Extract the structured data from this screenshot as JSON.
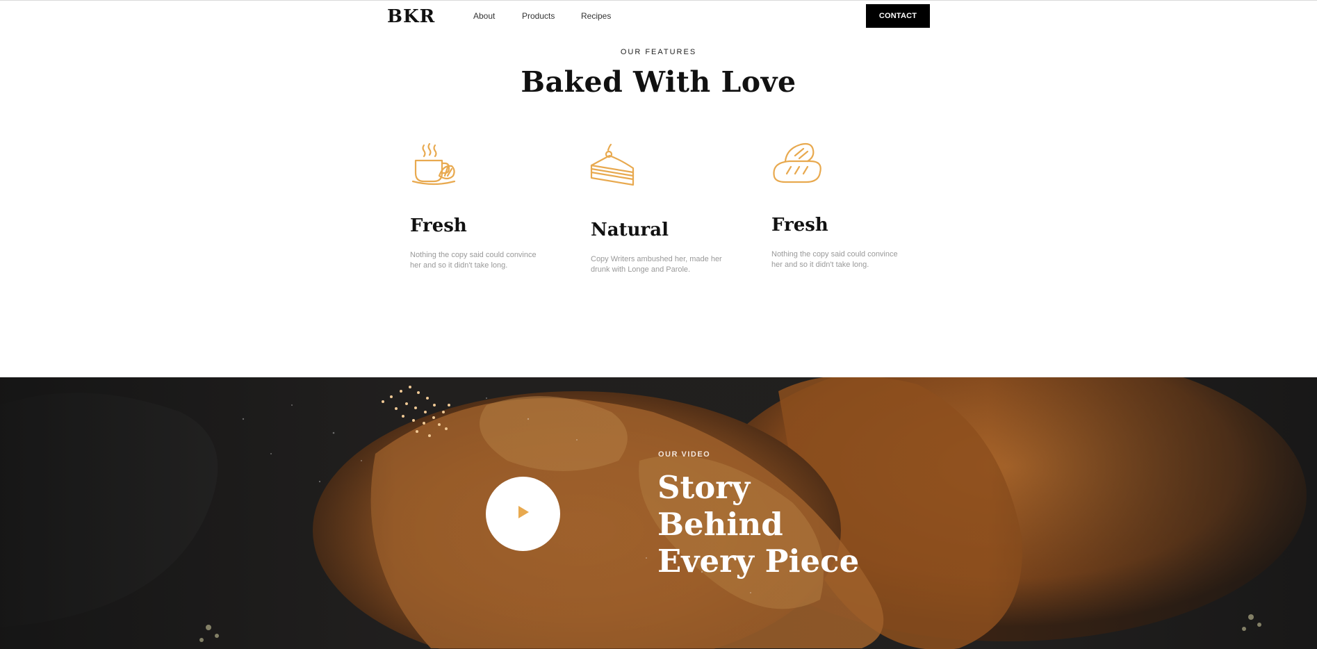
{
  "nav": {
    "logo": "BKR",
    "links": [
      "About",
      "Products",
      "Recipes"
    ],
    "contact_label": "CONTACT"
  },
  "features_section": {
    "eyebrow": "OUR FEATURES",
    "title": "Baked With Love",
    "items": [
      {
        "icon": "coffee-croissant-icon",
        "title": "Fresh",
        "desc": "Nothing the copy said could convince her and so it didn't take long."
      },
      {
        "icon": "cake-slice-icon",
        "title": "Natural",
        "desc": "Copy Writers ambushed her, made her drunk with Longe and Parole."
      },
      {
        "icon": "bread-loaf-icon",
        "title": "Fresh",
        "desc": "Nothing the copy said could convince her and so it didn't take long."
      }
    ]
  },
  "video_section": {
    "eyebrow": "OUR VIDEO",
    "title_lines": [
      "Story",
      "Behind",
      "Every Piece"
    ]
  },
  "colors": {
    "accent": "#E8A94F",
    "text": "#111111",
    "muted": "#999999"
  }
}
